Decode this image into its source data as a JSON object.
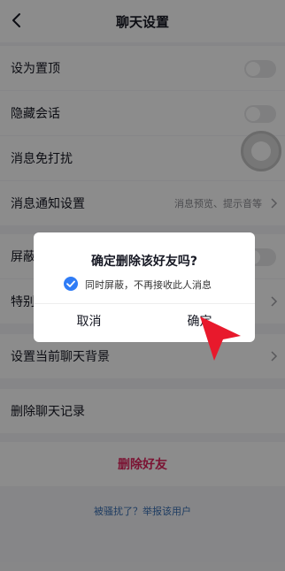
{
  "header": {
    "title": "聊天设置"
  },
  "settings": [
    {
      "label": "设为置顶",
      "control": "toggle"
    },
    {
      "label": "隐藏会话",
      "control": "toggle"
    },
    {
      "label": "消息免打扰",
      "control": "toggle"
    },
    {
      "label": "消息通知设置",
      "value": "消息预览、提示音等",
      "control": "chevron"
    },
    {
      "label": "屏蔽",
      "control": "toggle"
    },
    {
      "label": "特别",
      "value": "",
      "control": "chevron"
    },
    {
      "label": "设置当前聊天背景",
      "control": "chevron"
    },
    {
      "label": "删除聊天记录",
      "control": "none"
    }
  ],
  "delete_friend": {
    "label": "删除好友",
    "color": "#e0245e"
  },
  "report_link": "被骚扰了？举报该用户",
  "dialog": {
    "title": "确定删除该好友吗?",
    "checkbox_label": "同时屏蔽，不再接收此人消息",
    "checkbox_checked": true,
    "cancel_label": "取消",
    "confirm_label": "确定"
  },
  "colors": {
    "accent": "#2f7cf6",
    "pointer": "#e8192c"
  }
}
